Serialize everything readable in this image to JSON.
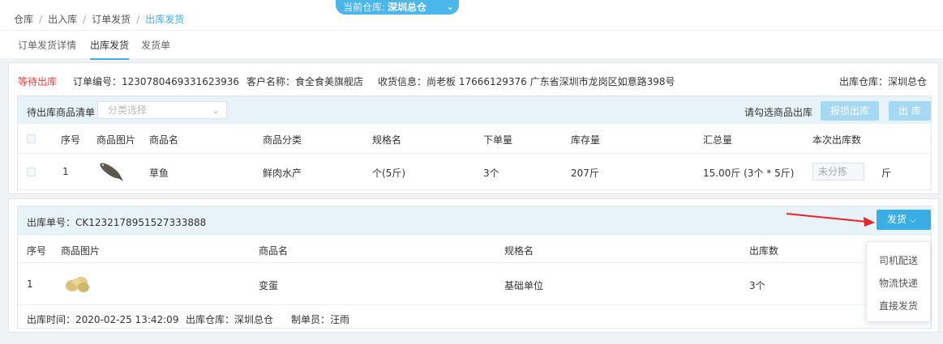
{
  "breadcrumb": [
    "仓库",
    "出入库",
    "订单发货",
    "出库发货"
  ],
  "warehouse_selector": {
    "label": "当前仓库:",
    "value": "深圳总仓"
  },
  "tabs": [
    "订单发货详情",
    "出库发货",
    "发货单"
  ],
  "order": {
    "status": "等待出库",
    "order_no": "订单编号：1230780469331623936",
    "customer": "客户名称：食全食美旗舰店",
    "shipping": "收货信息：尚老板 17666129376 广东省深圳市龙岗区如意路398号",
    "warehouse": "出库仓库：深圳总仓"
  },
  "pending": {
    "title": "待出库商品清单",
    "category_placeholder": "分类选择",
    "hint": "请勾选商品出库",
    "report_loss_label": "报损出库",
    "outbound_label": "出 库",
    "columns": [
      "序号",
      "商品图片",
      "商品名",
      "商品分类",
      "规格名",
      "下单量",
      "库存量",
      "汇总量",
      "本次出库数"
    ],
    "rows": [
      {
        "index": "1",
        "name": "草鱼",
        "category": "鲜肉水产",
        "spec": "个(5斤)",
        "order_qty": "3个",
        "stock": "207斤",
        "total": "15.00斤 (3个 * 5斤)",
        "qty_placeholder": "未分拣",
        "unit": "斤"
      }
    ]
  },
  "outbound": {
    "number": "出库单号：CK1232178951527333888",
    "ship_label": "发货",
    "columns": [
      "序号",
      "商品图片",
      "商品名",
      "规格名",
      "出库数"
    ],
    "rows": [
      {
        "index": "1",
        "name": "变蛋",
        "spec": "基础单位",
        "qty": "3个"
      }
    ],
    "footer": {
      "time": "出库时间：2020-02-25 13:42:09",
      "warehouse": "出库仓库：深圳总仓",
      "creator": "制单员：汪雨"
    }
  },
  "ship_menu": [
    "司机配送",
    "物流快递",
    "直接发货"
  ],
  "colors": {
    "accent": "#39aee5",
    "status_red": "#e64340",
    "annotation_arrow": "#e8262a"
  }
}
